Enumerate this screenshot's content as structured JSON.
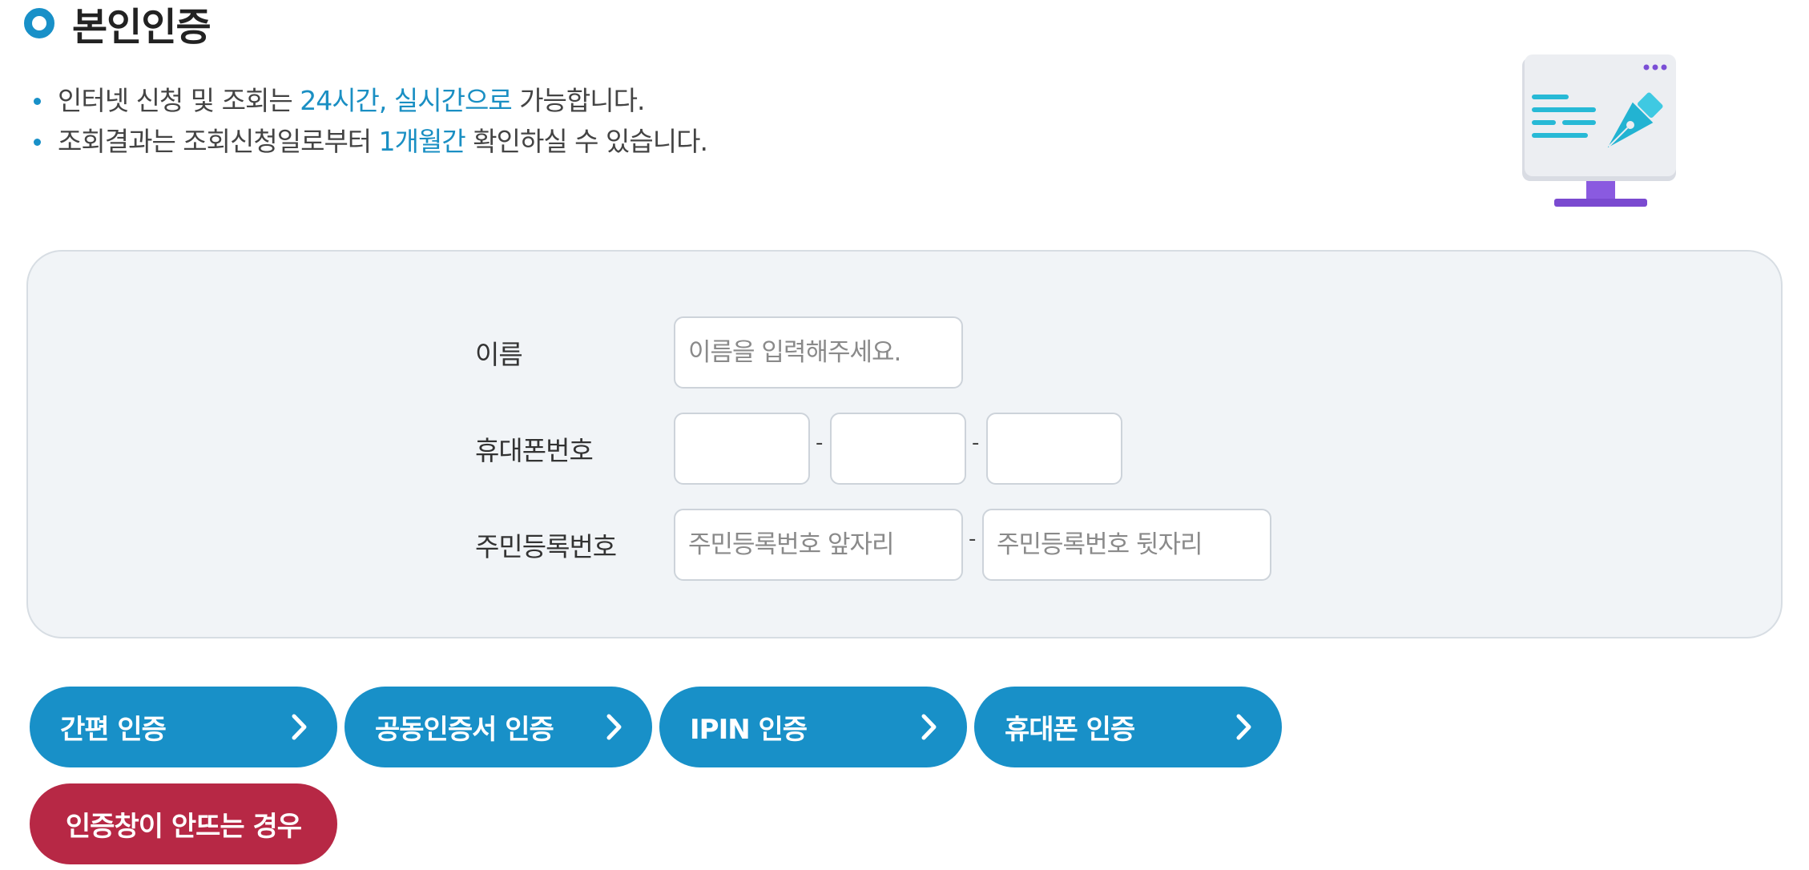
{
  "header": {
    "title": "본인인증"
  },
  "notices": [
    {
      "before": "인터넷 신청 및 조회는 ",
      "highlight": "24시간, 실시간으로",
      "after": " 가능합니다."
    },
    {
      "before": "조회결과는 조회신청일로부터 ",
      "highlight": "1개월간",
      "after": " 확인하실 수 있습니다."
    }
  ],
  "form": {
    "name_label": "이름",
    "name_placeholder": "이름을 입력해주세요.",
    "phone_label": "휴대폰번호",
    "phone_separator": "-",
    "rrn_label": "주민등록번호",
    "rrn_front_placeholder": "주민등록번호 앞자리",
    "rrn_separator": "-",
    "rrn_back_placeholder": "주민등록번호 뒷자리"
  },
  "auth_buttons": [
    {
      "label": "간편 인증"
    },
    {
      "label": "공동인증서 인증"
    },
    {
      "label": "IPIN 인증"
    },
    {
      "label": "휴대폰 인증"
    }
  ],
  "help_button": {
    "label": "인증창이 안뜨는 경우"
  },
  "colors": {
    "accent": "#1890c8",
    "highlight_text": "#1a8fc3",
    "help_button": "#b72845",
    "panel_background": "#f1f4f7"
  },
  "icons": {
    "section": "ring-icon",
    "illustration": "monitor-pen-illustration",
    "button_arrow": "chevron-right-icon"
  }
}
